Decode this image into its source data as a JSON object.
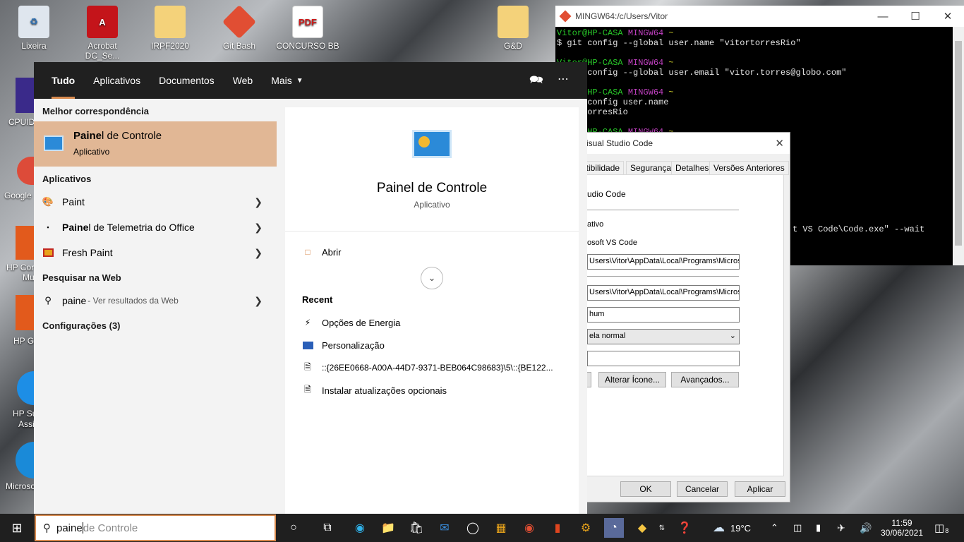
{
  "desktop": {
    "icons": [
      {
        "label": "Lixeira"
      },
      {
        "label": "Acrobat DC_Se..."
      },
      {
        "label": "IRPF2020"
      },
      {
        "label": "Git Bash"
      },
      {
        "label": "CONCURSO BB"
      },
      {
        "label": "G&D"
      }
    ],
    "partial_labels": [
      "CPUID",
      "Google",
      "HP Cor",
      "Mu",
      "HP G",
      "HP Su",
      "Assi",
      "Microso"
    ]
  },
  "terminal": {
    "title": "MINGW64:/c/Users/Vitor",
    "lines": [
      {
        "prompt_user": "Vitor@HP-CASA",
        "prompt_env": "MINGW64",
        "prompt_dir": "~"
      },
      {
        "text": "$ git config --global user.name \"vitortorresRio\""
      },
      {
        "text": ""
      },
      {
        "prompt_user": "Vitor@HP-CASA",
        "prompt_env": "MINGW64",
        "prompt_dir": "~"
      },
      {
        "text": "$ git config --global user.email \"vitor.torres@globo.com\""
      },
      {
        "text": ""
      },
      {
        "prompt_user": "Vitor@HP-CASA",
        "prompt_env": "MINGW64",
        "prompt_dir": "~"
      },
      {
        "text": "$ git config user.name"
      },
      {
        "text": "vitortorresRio"
      },
      {
        "text": ""
      },
      {
        "prompt_user": "Vitor@HP-CASA",
        "prompt_env": "MINGW64",
        "prompt_dir": "~"
      }
    ],
    "wait_line": "t VS Code\\Code.exe\" --wait"
  },
  "properties": {
    "title": "isual Studio Code",
    "tabs": [
      "atibilidade",
      "Segurança",
      "Detalhes",
      "Versões Anteriores"
    ],
    "name_value": "udio Code",
    "type_value": "ativo",
    "location_value": "osoft VS Code",
    "target_value": "Users\\Vitor\\AppData\\Local\\Programs\\Micros",
    "start_in_value": "Users\\Vitor\\AppData\\Local\\Programs\\Micros",
    "shortcut_value": "hum",
    "run_value": "ela normal",
    "change_icon": "Alterar Ícone...",
    "advanced": "Avançados...",
    "ok": "OK",
    "cancel": "Cancelar",
    "apply": "Aplicar"
  },
  "search": {
    "tabs": [
      "Tudo",
      "Aplicativos",
      "Documentos",
      "Web",
      "Mais"
    ],
    "best_match_header": "Melhor correspondência",
    "best_match": {
      "title_bold": "Paine",
      "title_rest": "l de Controle",
      "subtitle": "Aplicativo"
    },
    "apps_header": "Aplicativos",
    "apps": [
      {
        "bold": "",
        "name": "Paint"
      },
      {
        "bold": "Paine",
        "name": "l de Telemetria do Office"
      },
      {
        "bold": "",
        "name": "Fresh Paint"
      }
    ],
    "web_header": "Pesquisar na Web",
    "web_query": "paine",
    "web_suffix": " - Ver resultados da Web",
    "settings_header": "Configurações (3)",
    "detail": {
      "title": "Painel de Controle",
      "subtitle": "Aplicativo",
      "open": "Abrir",
      "recent_header": "Recent",
      "recent": [
        "Opções de Energia",
        "Personalização",
        "::{26EE0668-A00A-44D7-9371-BEB064C98683}\\5\\::{BE122...",
        "Instalar atualizações opcionais"
      ]
    }
  },
  "taskbar": {
    "query_typed": "paine",
    "query_hint": " de Controle",
    "weather": "19°C",
    "time": "11:59",
    "date": "30/06/2021",
    "notifications": "8"
  },
  "colors": {
    "accent": "#d98b4f",
    "best_match_bg": "#e1b795",
    "taskbar": "#1f1f1f",
    "search_header": "#202020"
  }
}
